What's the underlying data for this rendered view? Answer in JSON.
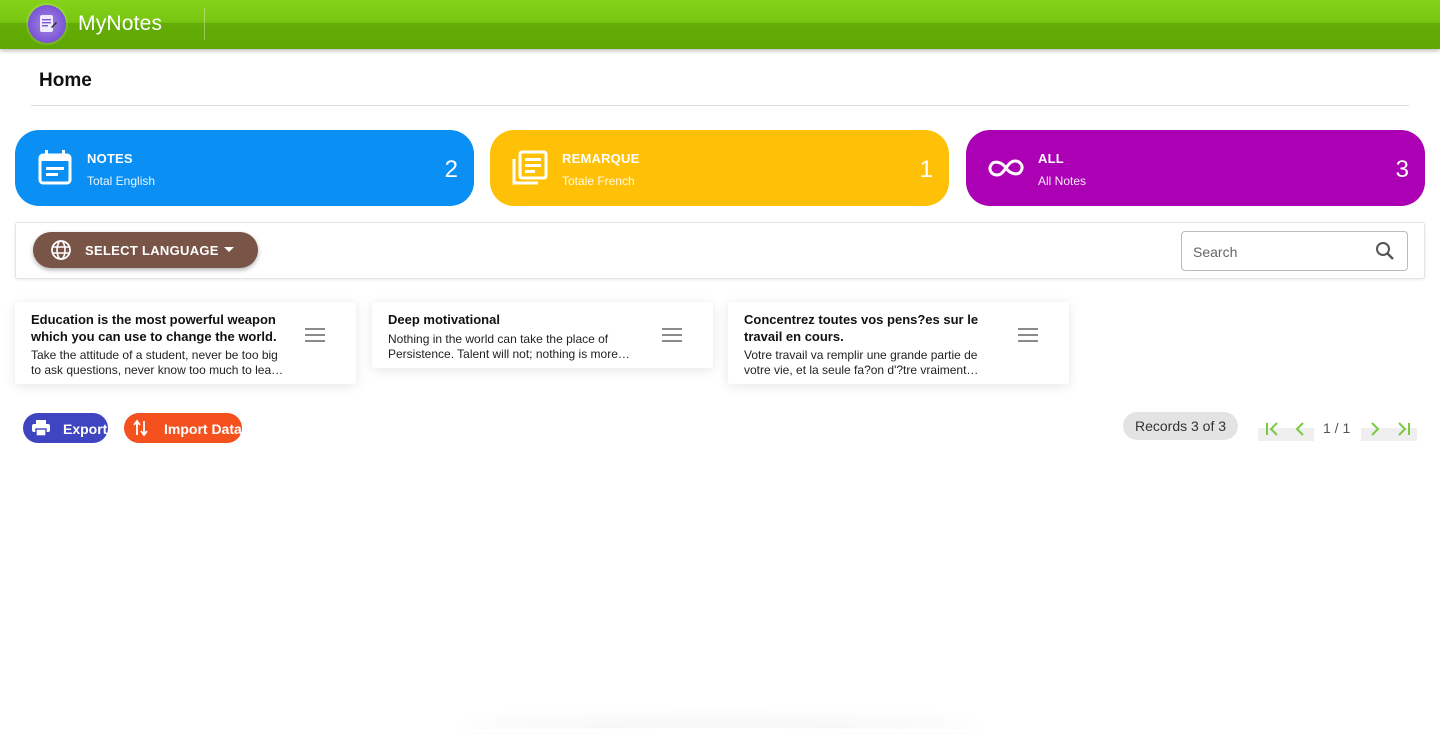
{
  "app": {
    "title": "MyNotes"
  },
  "page": {
    "title": "Home"
  },
  "stats": [
    {
      "label": "NOTES",
      "sub": "Total English",
      "count": "2",
      "color": "#0a8ff5",
      "icon": "calendar-note-icon"
    },
    {
      "label": "REMARQUE",
      "sub": "Totale French",
      "count": "1",
      "color": "#ffc107",
      "icon": "library-books-icon"
    },
    {
      "label": "ALL",
      "sub": "All Notes",
      "count": "3",
      "color": "#ab00b4",
      "icon": "infinity-icon"
    }
  ],
  "toolbar": {
    "language_label": "SELECT LANGUAGE",
    "search_placeholder": "Search"
  },
  "notes": [
    {
      "title": "Education is the most powerful weapon which you can use to change the world.",
      "body": "Take the attitude of a student, never be too big to ask questions, never know too much to learn something new."
    },
    {
      "title": "Deep motivational",
      "body": "Nothing in the world can take the place of Persistence. Talent will not; nothing is more common than unsuccessful men with talent."
    },
    {
      "title": "Concentrez toutes vos pens?es sur le travail en cours.",
      "body": "Votre travail va remplir une grande partie de votre vie, et la seule fa?on d'?tre vraiment satisfait."
    }
  ],
  "actions": {
    "export_label": "Export",
    "import_label": "Import Data"
  },
  "pagination": {
    "records_text": "Records 3 of 3",
    "page_indicator": "1 / 1"
  },
  "colors": {
    "appbar": "#6cb70a",
    "language_button": "#795548",
    "export": "#3f45c0",
    "import": "#f4511e",
    "pager_arrows": "#7ac943"
  }
}
